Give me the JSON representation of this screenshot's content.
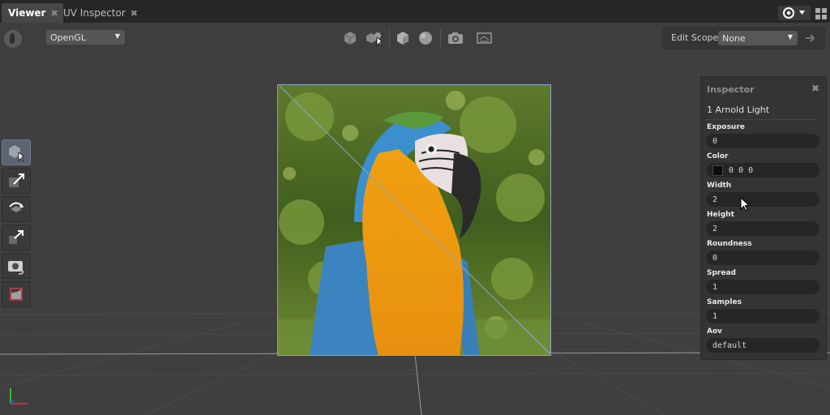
{
  "tabs": [
    {
      "label": "Viewer",
      "close": "✖"
    },
    {
      "label": "UV Inspector",
      "close": "✖"
    }
  ],
  "toolbar": {
    "renderer": "OpenGL",
    "edit_scope_label": "Edit Scope",
    "edit_scope_value": "None"
  },
  "inspector": {
    "title": "Inspector",
    "close": "✖",
    "node": "1 Arnold Light",
    "params": [
      {
        "label": "Exposure",
        "value": "0"
      },
      {
        "label": "Color",
        "value": "0 0 0"
      },
      {
        "label": "Width",
        "value": "2"
      },
      {
        "label": "Height",
        "value": "2"
      },
      {
        "label": "Roundness",
        "value": "0"
      },
      {
        "label": "Spread",
        "value": "1"
      },
      {
        "label": "Samples",
        "value": "1"
      },
      {
        "label": "Aov",
        "value": "default"
      }
    ]
  },
  "colors": {
    "selection_outline": "#8aa6c8",
    "axis_x": "#d03030",
    "axis_y": "#30c030",
    "axis_z": "#3050d0"
  },
  "icons": [
    "hand-icon",
    "cube-icon",
    "cubes-cursor-icon",
    "cube-shaded-icon",
    "sphere-icon",
    "camera-icon",
    "layers-icon",
    "arrow-right-icon",
    "target-icon",
    "grid-layout-icon",
    "select-tool-icon",
    "translate-tool-icon",
    "rotate-tool-icon",
    "scale-tool-icon",
    "camera-tool-icon",
    "crop-tool-icon"
  ]
}
